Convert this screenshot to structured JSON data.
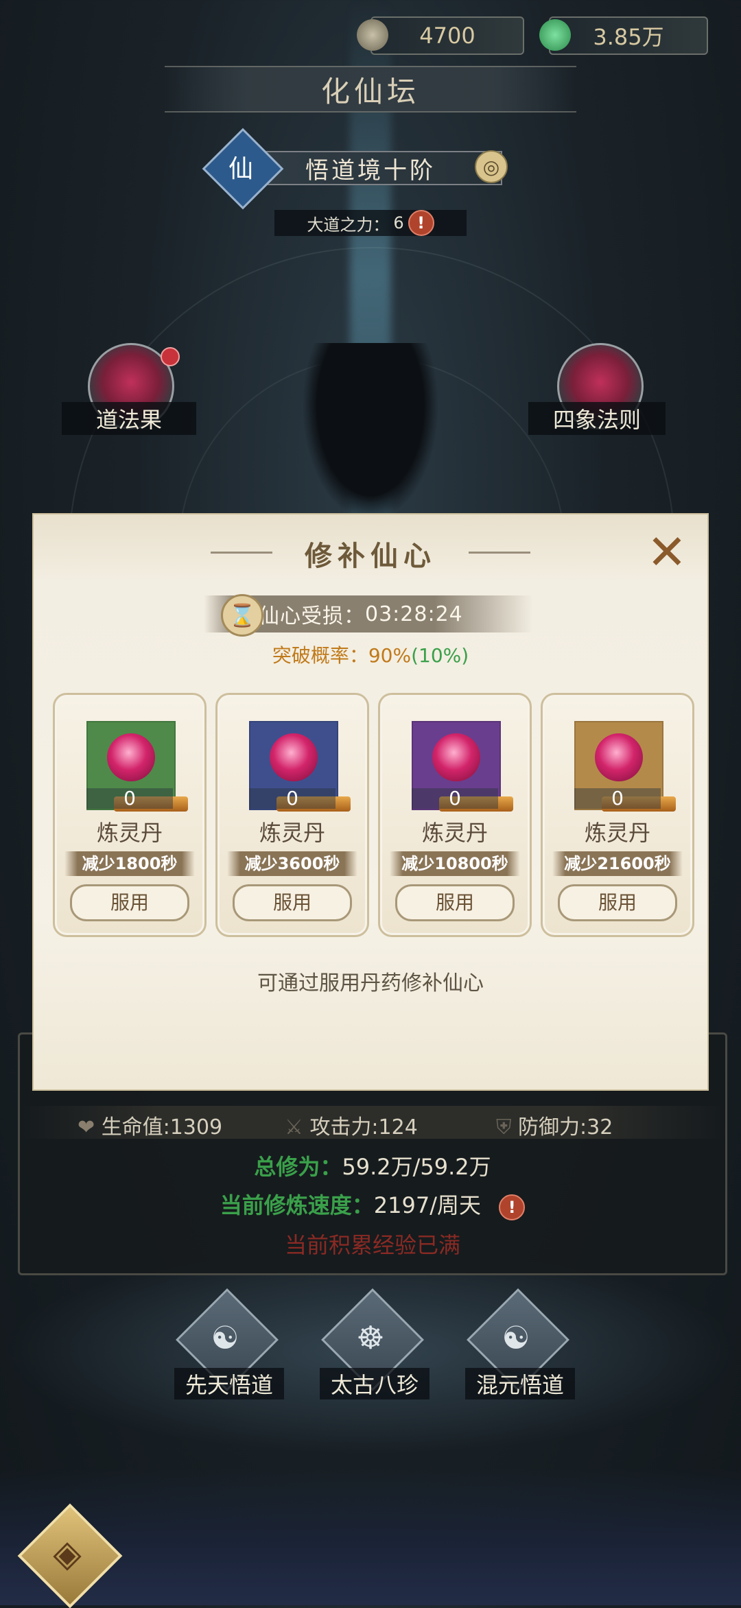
{
  "currencies": [
    {
      "icon": "spirit-stone-icon",
      "value": "4700"
    },
    {
      "icon": "jade-coin-icon",
      "value": "3.85万"
    }
  ],
  "title": "化仙坛",
  "realm": {
    "badge": "仙",
    "name": "悟道境十阶"
  },
  "dao_power": {
    "label": "大道之力：",
    "value": "6"
  },
  "side": {
    "left_label": "道法果",
    "right_label": "四象法则"
  },
  "modal": {
    "title": "修补仙心",
    "timer_label": "仙心受损：",
    "timer_value": "03:28:24",
    "prob_label": "突破概率：",
    "prob_value": "90%",
    "prob_extra": "(10%)",
    "hint": "可通过服用丹药修补仙心",
    "items": [
      {
        "name": "炼灵丹",
        "qty": "0",
        "reduce": "减少1800秒",
        "button": "服用",
        "bg": "#4f8a4a"
      },
      {
        "name": "炼灵丹",
        "qty": "0",
        "reduce": "减少3600秒",
        "button": "服用",
        "bg": "#3f4f8e"
      },
      {
        "name": "炼灵丹",
        "qty": "0",
        "reduce": "减少10800秒",
        "button": "服用",
        "bg": "#6a3e8e"
      },
      {
        "name": "炼灵丹",
        "qty": "0",
        "reduce": "减少21600秒",
        "button": "服用",
        "bg": "#b48a4a"
      }
    ]
  },
  "stats": {
    "hp_label": "生命值:",
    "hp_value": "1309",
    "atk_label": "攻击力:",
    "atk_value": "124",
    "def_label": "防御力:",
    "def_value": "32",
    "total_label": "总修为：",
    "total_value": "59.2万/59.2万",
    "speed_label": "当前修炼速度：",
    "speed_value": "2197/周天",
    "full_notice": "当前积累经验已满"
  },
  "bottom_buttons": [
    "先天悟道",
    "太古八珍",
    "混元悟道"
  ],
  "colors": {
    "accent_green": "#3aa04a",
    "accent_orange": "#c07a1a",
    "alert_red": "#b0432b",
    "notice_red": "#8a2a24"
  }
}
